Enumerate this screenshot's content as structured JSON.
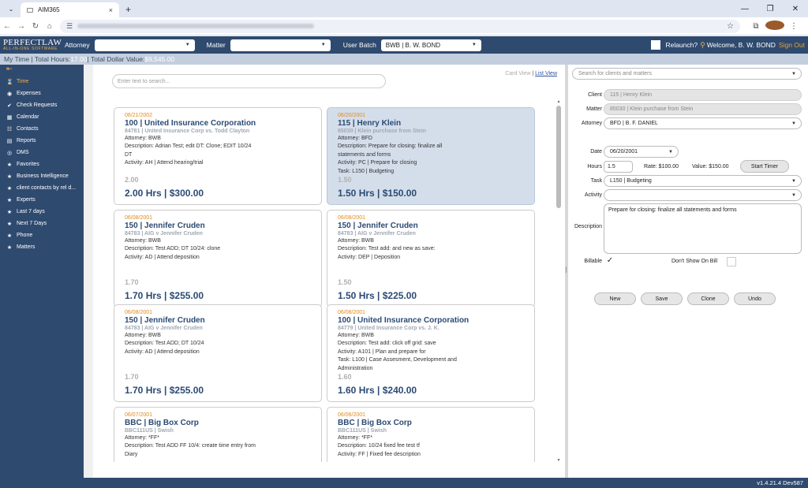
{
  "browser": {
    "tab_title": "AIM365",
    "tab_close": "×",
    "new_tab": "+"
  },
  "header": {
    "logo_main": "PERFECTLAW",
    "logo_sub": "ALL-IN-ONE SOFTWARE",
    "attorney_label": "Attorney",
    "attorney_value": "",
    "matter_label": "Matter",
    "matter_value": "",
    "user_batch_label": "User Batch",
    "user_batch_value": "BWB | B. W. BOND",
    "relaunch_label": "Relaunch?",
    "welcome": "Welcome, B. W. BOND",
    "sign_out": "Sign Out"
  },
  "status": {
    "prefix": "My Time | Total Hours: ",
    "hours": "17.00",
    "mid": " | Total Dollar Value: ",
    "dollars": "$9,545.00"
  },
  "sidebar": {
    "items": [
      {
        "label": "Time",
        "icon": "hourglass-icon",
        "glyph": "⌛",
        "active": true
      },
      {
        "label": "Expenses",
        "icon": "coins-icon",
        "glyph": "◉"
      },
      {
        "label": "Check Requests",
        "icon": "check-icon",
        "glyph": "✔"
      },
      {
        "label": "Calendar",
        "icon": "calendar-icon",
        "glyph": "▦"
      },
      {
        "label": "Contacts",
        "icon": "contacts-icon",
        "glyph": "☷"
      },
      {
        "label": "Reports",
        "icon": "report-icon",
        "glyph": "▤"
      },
      {
        "label": "DMS",
        "icon": "database-icon",
        "glyph": "◎"
      },
      {
        "label": "Favorites",
        "icon": "star-icon",
        "glyph": "★"
      },
      {
        "label": "Business Intelligence",
        "icon": "star-icon",
        "glyph": "★"
      },
      {
        "label": "client contacts by rel d...",
        "icon": "star-icon",
        "glyph": "★"
      },
      {
        "label": "Experts",
        "icon": "star-icon",
        "glyph": "★"
      },
      {
        "label": "Last 7 days",
        "icon": "star-icon",
        "glyph": "★"
      },
      {
        "label": "Next 7 Days",
        "icon": "star-icon",
        "glyph": "★"
      },
      {
        "label": "Phone",
        "icon": "star-icon",
        "glyph": "★"
      },
      {
        "label": "Matters",
        "icon": "star-icon",
        "glyph": "★"
      }
    ]
  },
  "main": {
    "search_placeholder": "Enter text to search...",
    "card_view": "Card View",
    "list_view": "List View",
    "cards": [
      {
        "date": "06/21/2002",
        "title": "100 | United Insurance Corporation",
        "matter": "84781 | United Insurance Corp vs. Todd Clayton",
        "lines": [
          "Attorney: BWB",
          "Description: Adrian Test; edit DT: Clone; EDIT 10/24",
          "DT",
          "Activity: AH | Attend hearing/trial"
        ],
        "hours": "2.00",
        "total": "2.00 Hrs | $300.00",
        "selected": false
      },
      {
        "date": "06/20/2001",
        "title": "115 | Henry Klein",
        "matter": "85030 | Klein purchase from Stein",
        "lines": [
          "Attorney: BFD",
          "Description: Prepare for closing: finalize all",
          "statements and forms",
          "Activity: PC | Prepare for closing",
          "Task: L150 | Budgeting"
        ],
        "hours": "1.50",
        "total": "1.50 Hrs | $150.00",
        "selected": true
      },
      {
        "date": "06/08/2001",
        "title": "150 | Jennifer Cruden",
        "matter": "84783 | AIG v Jennifer Cruden",
        "lines": [
          "Attorney: BWB",
          "Description: Test ADD; DT 10/24: clone",
          "Activity: AD | Attend deposition"
        ],
        "hours": "1.70",
        "total": "1.70 Hrs | $255.00",
        "selected": false
      },
      {
        "date": "06/08/2001",
        "title": "150 | Jennifer Cruden",
        "matter": "84783 | AIG v Jennifer Cruden",
        "lines": [
          "Attorney: BWB",
          "Description: Test add: and new as save:",
          "Activity: DEP | Deposition"
        ],
        "hours": "1.50",
        "total": "1.50 Hrs | $225.00",
        "selected": false
      },
      {
        "date": "06/08/2001",
        "title": "150 | Jennifer Cruden",
        "matter": "84783 | AIG v Jennifer Cruden",
        "lines": [
          "Attorney: BWB",
          "Description: Test ADD; DT 10/24",
          "Activity: AD | Attend deposition"
        ],
        "hours": "1.70",
        "total": "1.70 Hrs | $255.00",
        "selected": false
      },
      {
        "date": "06/08/2001",
        "title": "100 | United Insurance Corporation",
        "matter": "84779 | United Insurance Corp vs. J. K.",
        "lines": [
          "Attorney: BWB",
          "Description: Test add: click off grid: save",
          "Activity: A101 | Plan and prepare for",
          "Task: L100 | Case Assesment, Development and",
          "Administration"
        ],
        "hours": "1.60",
        "total": "1.60 Hrs | $240.00",
        "selected": false
      },
      {
        "date": "06/07/2001",
        "title": "BBC | Big Box Corp",
        "matter": "BBC111US | Swish",
        "lines": [
          "Attorney: *FF*",
          "Description: Test ADD FF 10/4: create time entry from",
          "Diary"
        ],
        "hours": "",
        "total": "",
        "selected": false
      },
      {
        "date": "06/06/2001",
        "title": "BBC | Big Box Corp",
        "matter": "BBC111US | Swish",
        "lines": [
          "Attorney: *FF*",
          "Description: 10/24 fixed fee test tf",
          "Activity: FF | Fixed fee description"
        ],
        "hours": "",
        "total": "",
        "selected": false
      }
    ]
  },
  "detail": {
    "search_placeholder": "Search for clients and matters",
    "client_label": "Client",
    "client_value": "115 | Henry Klein",
    "matter_label": "Matter",
    "matter_value": "85030 | Klein purchase from Stein",
    "attorney_label": "Attorney",
    "attorney_value": "BFD | B. F. DANIEL",
    "date_label": "Date",
    "date_value": "06/20/2001",
    "hours_label": "Hours",
    "hours_value": "1.5",
    "rate": "Rate: $100.00",
    "value": "Value: $150.00",
    "start_timer": "Start Timer",
    "task_label": "Task",
    "task_value": "L150 | Budgeting",
    "activity_label": "Activity",
    "activity_value": "",
    "description_label": "Description",
    "description_value": "Prepare for closing: finalize all statements and forms",
    "billable_label": "Billable",
    "dont_show_label": "Don't Show On Bill",
    "buttons": {
      "new": "New",
      "save": "Save",
      "clone": "Clone",
      "undo": "Undo"
    }
  },
  "footer": {
    "version": "v1.4.21.4 Dev587"
  },
  "colors": {
    "brand": "#2f4a6f",
    "accent": "#f0a030",
    "title": "#2b4a74"
  }
}
